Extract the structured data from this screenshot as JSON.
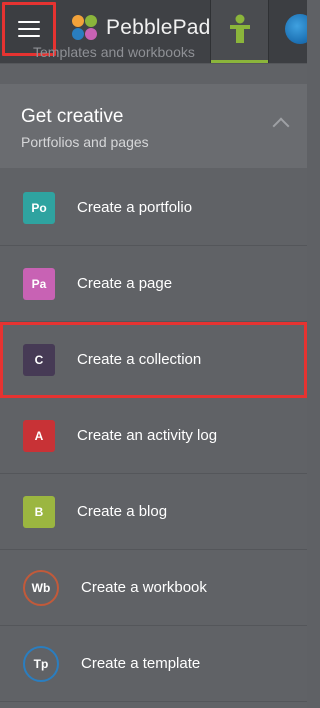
{
  "topbar": {
    "brand": "PebblePad",
    "faded_text": "Templates and workbooks"
  },
  "section": {
    "title": "Get creative",
    "subtitle": "Portfolios and pages"
  },
  "items": [
    {
      "badge": "Po",
      "label": "Create a portfolio",
      "color": "#2fa3a0"
    },
    {
      "badge": "Pa",
      "label": "Create a page",
      "color": "#c862b4"
    },
    {
      "badge": "C",
      "label": "Create a collection",
      "color": "#463a55"
    },
    {
      "badge": "A",
      "label": "Create an activity log",
      "color": "#c83236"
    },
    {
      "badge": "B",
      "label": "Create a blog",
      "color": "#9bb640"
    },
    {
      "badge": "Wb",
      "label": "Create a workbook",
      "color": "#c25a3a"
    },
    {
      "badge": "Tp",
      "label": "Create a template",
      "color": "#2a7ec0"
    }
  ],
  "colors": {
    "highlight": "#e63331",
    "accent_green": "#8bb53b"
  }
}
